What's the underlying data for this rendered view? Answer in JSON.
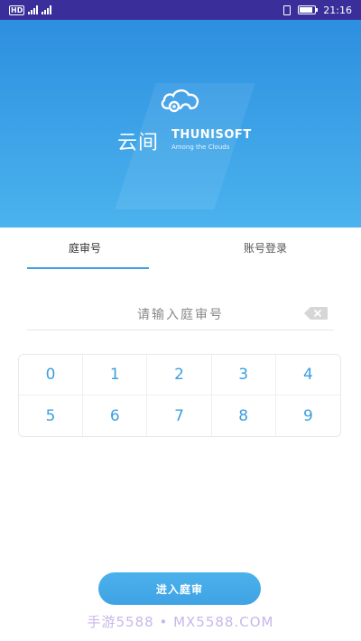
{
  "status_bar": {
    "left_badge": "HD",
    "time": "21:16"
  },
  "hero": {
    "logo_cn": "云间",
    "logo_en": "THUNISOFT",
    "logo_tagline": "Among the Clouds"
  },
  "tabs": [
    {
      "label": "庭审号"
    },
    {
      "label": "账号登录"
    }
  ],
  "input": {
    "placeholder": "请输入庭审号"
  },
  "keypad": {
    "keys": [
      "0",
      "1",
      "2",
      "3",
      "4",
      "5",
      "6",
      "7",
      "8",
      "9"
    ]
  },
  "enter_button": {
    "label": "进入庭审"
  },
  "watermark": {
    "text": "手游5588 • MX5588.COM"
  },
  "colors": {
    "accent": "#3fa0e6",
    "status_bar": "#3a2f9a"
  }
}
